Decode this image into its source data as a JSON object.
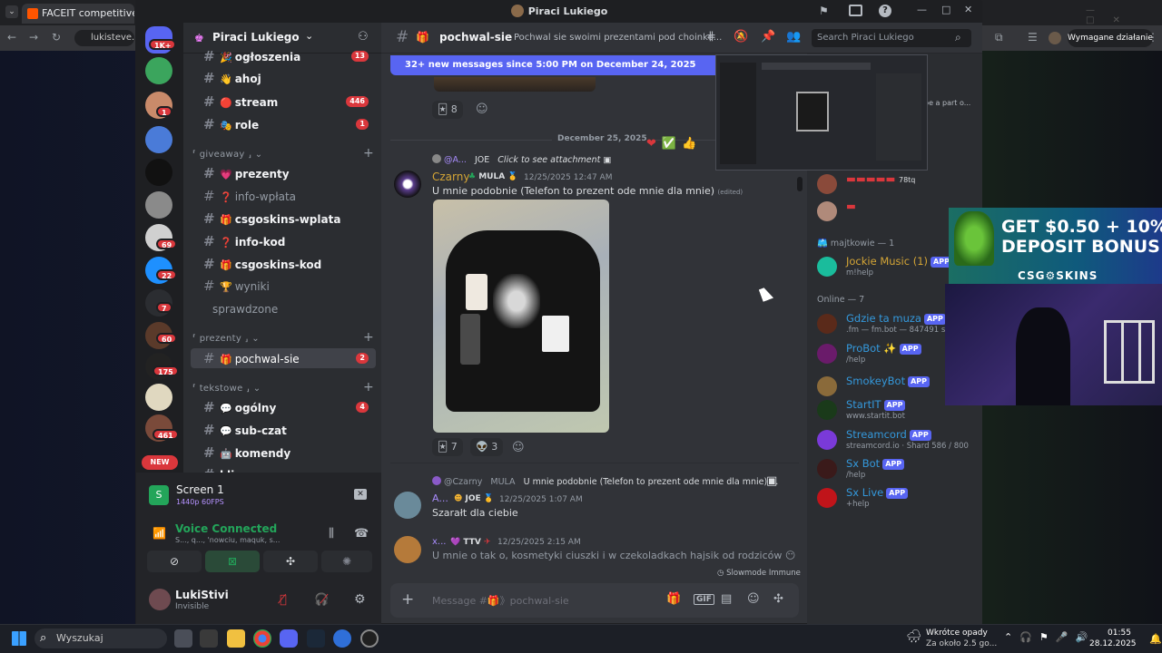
{
  "browser": {
    "tab_title": "FACEIT competitive match -",
    "url": "lukisteve.com",
    "action_button": "Wymagane działanie"
  },
  "window": {
    "title": "Piraci Lukiego"
  },
  "server": {
    "name": "Piraci Lukiego",
    "guild_badges": [
      "1K+",
      "1",
      "69",
      "22",
      "7",
      "60",
      "175",
      "461"
    ],
    "new_label": "NEW"
  },
  "channels": {
    "items": [
      {
        "emoji": "🎉",
        "name": "ogłoszenia",
        "badge": "13",
        "unread": true
      },
      {
        "emoji": "👋",
        "name": "ahoj",
        "badge": "",
        "unread": true
      },
      {
        "emoji": "🔴",
        "name": "stream",
        "badge": "446",
        "unread": true
      },
      {
        "emoji": "🎭",
        "name": "role",
        "badge": "1",
        "unread": true
      }
    ],
    "cat_giveaway": "giveaway",
    "giveaway": [
      {
        "emoji": "💗",
        "name": "prezenty",
        "unread": true
      },
      {
        "emoji": "❓",
        "name": "info-wpłata",
        "unread": false
      },
      {
        "emoji": "🎁",
        "name": "csgoskins-wplata",
        "unread": true
      },
      {
        "emoji": "❓",
        "name": "info-kod",
        "unread": true
      },
      {
        "emoji": "🎁",
        "name": "csgoskins-kod",
        "unread": true
      },
      {
        "emoji": "🏆",
        "name": "wyniki",
        "unread": false
      },
      {
        "emoji": "",
        "name": "sprawdzone",
        "unread": false
      }
    ],
    "cat_prezenty": "prezenty",
    "selected": {
      "emoji": "🎁",
      "name": "pochwal-sie",
      "badge": "2"
    },
    "cat_tekstowe": "tekstowe",
    "tekstowe": [
      {
        "emoji": "💬",
        "name": "ogólny",
        "badge": "4"
      },
      {
        "emoji": "💬",
        "name": "sub-czat",
        "badge": ""
      },
      {
        "emoji": "🤖",
        "name": "komendy",
        "badge": ""
      },
      {
        "emoji": "",
        "name": "klipy",
        "badge": ""
      }
    ]
  },
  "stream_panel": {
    "title": "Screen 1",
    "quality": "1440p 60FPS"
  },
  "voice": {
    "status": "Voice Connected",
    "members": "S..., q..., 'nowciu, maquk, s..."
  },
  "user": {
    "name": "LukiStivi",
    "status": "Invisible"
  },
  "channel_header": {
    "name": "pochwal-sie",
    "topic": "Pochwal sie swoimi prezentami pod choinke...",
    "search_placeholder": "Search Piraci Lukiego"
  },
  "new_messages_bar": "32+ new messages since 5:00 PM on December 24, 2025",
  "new_messages_mark": "M",
  "messages": {
    "top_react_count": "8",
    "date_divider": "December 25, 2025",
    "reply1": {
      "author": "@A...",
      "tag": "JOE",
      "text": "Click to see attachment"
    },
    "msg1": {
      "author": "Czarny",
      "tag": "MULA",
      "time": "12/25/2025 12:47 AM",
      "text": "U mnie podobnie (Telefon to prezent ode mnie dla mnie)",
      "edited": "(edited)",
      "react1": "7",
      "react2": "3"
    },
    "reply2": {
      "author": "@Czarny",
      "tag": "MULA",
      "text": "U mnie podobnie (Telefon to prezent ode mnie dla mnie) ..."
    },
    "msg2": {
      "author": "A...",
      "tag": "JOE",
      "time": "12/25/2025 1:07 AM",
      "text": "Szarałt dla ciebie"
    },
    "msg3": {
      "author": "x...",
      "tag": "TTV",
      "time": "12/25/2025 2:15 AM",
      "text": "U mnie o tak o, kosmetyki ciuszki i w czekoladkach hajsik od rodziców"
    },
    "slowmode": "Slowmode Immune"
  },
  "composer": {
    "placeholder": "Message #🎁》pochwal-sie"
  },
  "members": {
    "top_tag": "78tq",
    "role1": "majtkowie — 1",
    "jockie": {
      "name": "Jockie Music (1)",
      "sub": "m!help"
    },
    "role2": "Online — 7",
    "bots": [
      {
        "name": "Gdzie ta muza",
        "sub": ".fm — fm.bot — 847491 serve",
        "color": "#2ecc71"
      },
      {
        "name": "ProBot ✨",
        "sub": "/help",
        "color": "#5865f2"
      },
      {
        "name": "SmokeyBot",
        "sub": "",
        "color": "#2ecc71"
      },
      {
        "name": "StartIT",
        "sub": "www.startit.bot",
        "color": "#2ecc71"
      },
      {
        "name": "Streamcord",
        "sub": "streamcord.io · Shard 586 / 800",
        "color": "#5865f2"
      },
      {
        "name": "Sx Bot",
        "sub": "/help",
        "color": "#5865f2"
      },
      {
        "name": "Sx Live",
        "sub": "+help",
        "color": "#5865f2"
      }
    ],
    "app_label": "APP",
    "peek_text": "be a part o..."
  },
  "promo": {
    "line1": "GET $0.50 + 10%",
    "line2": "DEPOSIT BONUS",
    "brand": "CSG⚙SKINS"
  },
  "taskbar": {
    "search_placeholder": "Wyszukaj",
    "weather_title": "Wkrótce opady",
    "weather_sub": "Za około 2.5 go...",
    "time": "01:55",
    "date": "28.12.2025"
  },
  "colors": {
    "accent": "#5865f2",
    "danger": "#da373c",
    "online": "#23a55a"
  }
}
